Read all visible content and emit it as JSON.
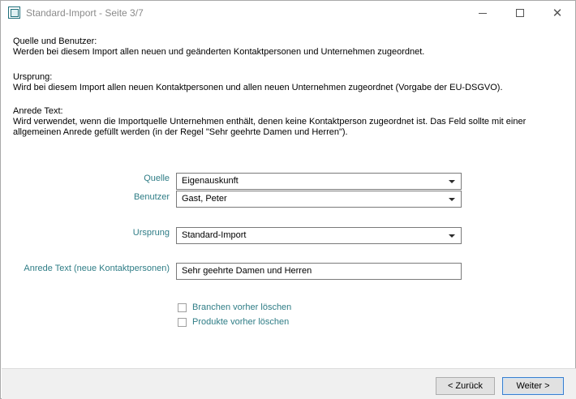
{
  "window": {
    "title": "Standard-Import - Seite 3/7",
    "controls": {
      "minimize": "minimize-icon",
      "maximize": "maximize-icon",
      "close": "close-icon"
    }
  },
  "description": {
    "quelle_heading": "Quelle und Benutzer:",
    "quelle_text": "Werden bei diesem Import allen neuen und geänderten Kontaktpersonen und Unternehmen zugeordnet.",
    "ursprung_heading": "Ursprung:",
    "ursprung_text": "Wird bei diesem Import allen neuen Kontaktpersonen und allen neuen Unternehmen zugeordnet (Vorgabe der EU-DSGVO).",
    "anrede_heading": "Anrede Text:",
    "anrede_text_line1": "Wird verwendet, wenn die Importquelle Unternehmen enthält, denen keine Kontaktperson zugeordnet ist. Das Feld sollte mit einer",
    "anrede_text_line2": "allgemeinen Anrede gefüllt werden (in der Regel \"Sehr geehrte Damen und Herren\")."
  },
  "form": {
    "quelle": {
      "label": "Quelle",
      "value": "Eigenauskunft"
    },
    "benutzer": {
      "label": "Benutzer",
      "value": "Gast, Peter"
    },
    "ursprung": {
      "label": "Ursprung",
      "value": "Standard-Import"
    },
    "anrede": {
      "label": "Anrede Text (neue Kontaktpersonen)",
      "value": "Sehr geehrte Damen und Herren"
    },
    "branchen_checkbox": {
      "label": "Branchen vorher löschen",
      "checked": false
    },
    "produkte_checkbox": {
      "label": "Produkte vorher löschen",
      "checked": false
    }
  },
  "footer": {
    "back_label": "< Zurück",
    "next_label": "Weiter >"
  },
  "colors": {
    "label": "#2f7d86",
    "title": "#8a8a8a",
    "accent_border": "#3a7fcf"
  }
}
